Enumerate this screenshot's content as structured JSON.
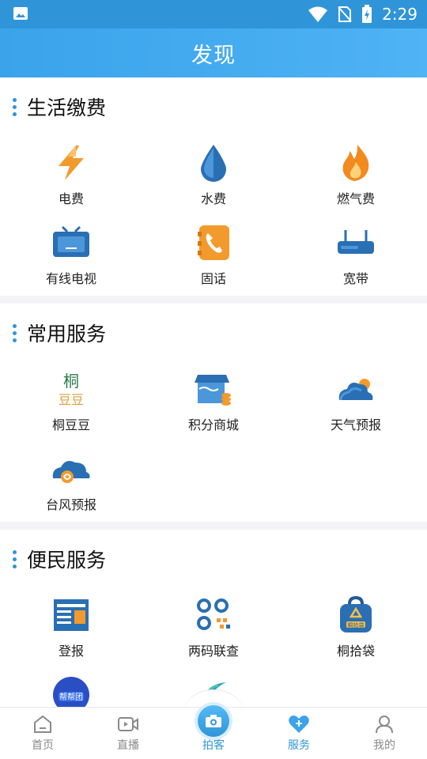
{
  "status_bar": {
    "time": "2:29"
  },
  "header": {
    "title": "发现"
  },
  "sections": [
    {
      "title": "生活缴费",
      "items": [
        {
          "label": "电费",
          "icon": "lightning-icon"
        },
        {
          "label": "水费",
          "icon": "water-drop-icon"
        },
        {
          "label": "燃气费",
          "icon": "flame-icon"
        },
        {
          "label": "有线电视",
          "icon": "tv-icon"
        },
        {
          "label": "固话",
          "icon": "phone-icon"
        },
        {
          "label": "宽带",
          "icon": "router-icon"
        }
      ]
    },
    {
      "title": "常用服务",
      "items": [
        {
          "label": "桐豆豆",
          "icon": "tongdoudou-logo-icon",
          "logo_text": "桐豆豆"
        },
        {
          "label": "积分商城",
          "icon": "store-icon"
        },
        {
          "label": "天气预报",
          "icon": "weather-icon"
        },
        {
          "label": "台风预报",
          "icon": "typhoon-icon"
        }
      ]
    },
    {
      "title": "便民服务",
      "items": [
        {
          "label": "登报",
          "icon": "newspaper-icon"
        },
        {
          "label": "两码联查",
          "icon": "qr-code-icon"
        },
        {
          "label": "桐拾袋",
          "icon": "recycle-bag-icon",
          "logo_text": "桐拾袋"
        },
        {
          "label": "",
          "icon": "bangbangtuan-logo-icon",
          "logo_text": "帮帮团"
        },
        {
          "label": "",
          "icon": "swoosh-logo-icon"
        }
      ]
    }
  ],
  "bottom_nav": [
    {
      "label": "首页",
      "icon": "home-icon"
    },
    {
      "label": "直播",
      "icon": "video-icon"
    },
    {
      "label": "拍客",
      "icon": "camera-icon"
    },
    {
      "label": "服务",
      "icon": "heart-icon"
    },
    {
      "label": "我的",
      "icon": "user-icon"
    }
  ],
  "colors": {
    "accent": "#2f95d8",
    "header_gradient_start": "#3aa3ea",
    "header_gradient_end": "#4fb3f5"
  }
}
